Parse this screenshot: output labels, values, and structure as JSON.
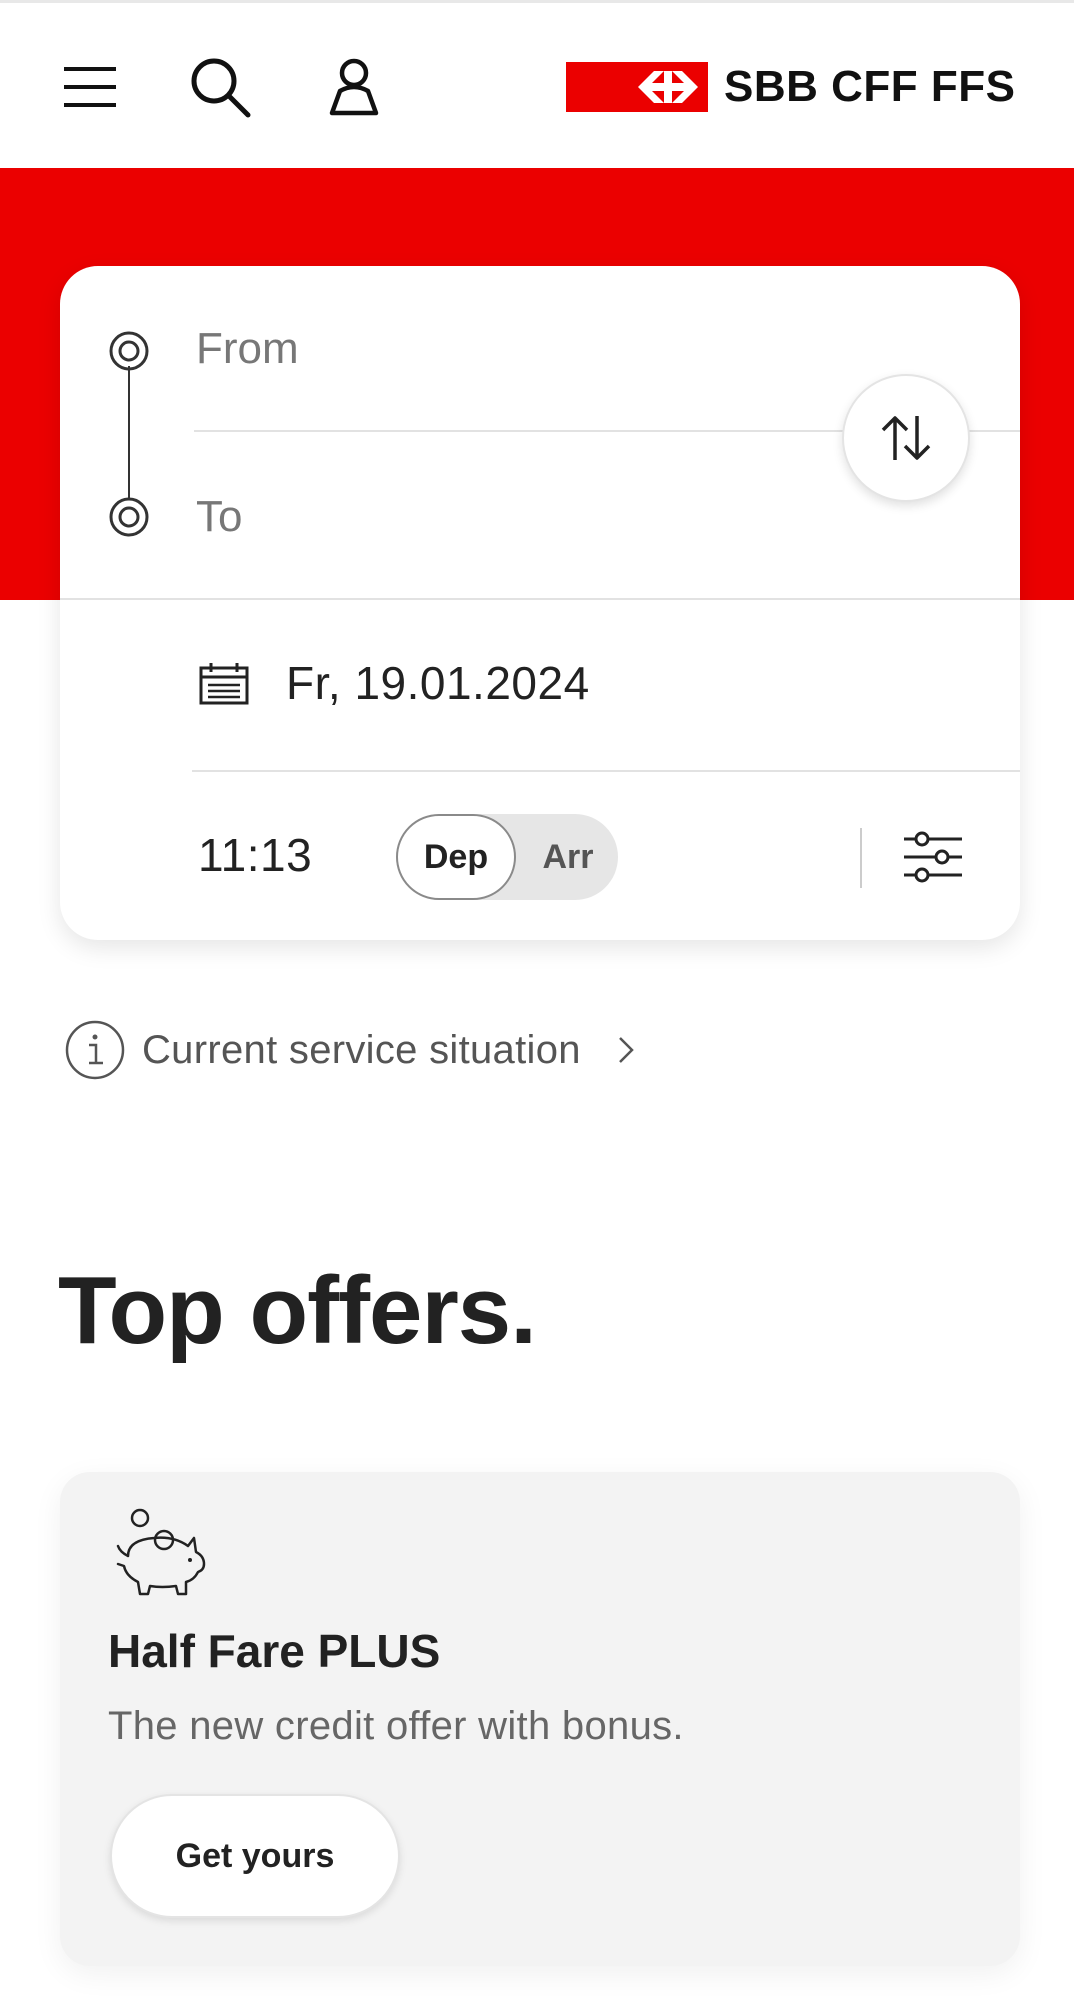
{
  "header": {
    "menu_icon": "hamburger-menu-icon",
    "search_icon": "search-icon",
    "account_icon": "user-icon",
    "logo_text": "SBB CFF FFS",
    "brand_color": "#eb0000"
  },
  "timetable": {
    "from_placeholder": "From",
    "to_placeholder": "To",
    "swap_icon": "swap-arrows-icon",
    "date": "Fr, 19.01.2024",
    "time": "11:13",
    "toggle": {
      "departure_label": "Dep",
      "arrival_label": "Arr",
      "selected": "Dep"
    },
    "filter_icon": "filter-sliders-icon"
  },
  "service_situation": {
    "label": "Current service situation",
    "icon": "info-icon"
  },
  "offers": {
    "title": "Top offers.",
    "items": [
      {
        "icon": "piggy-bank-icon",
        "title": "Half Fare PLUS",
        "description": "The new credit offer with bonus.",
        "button_label": "Get yours"
      }
    ]
  }
}
